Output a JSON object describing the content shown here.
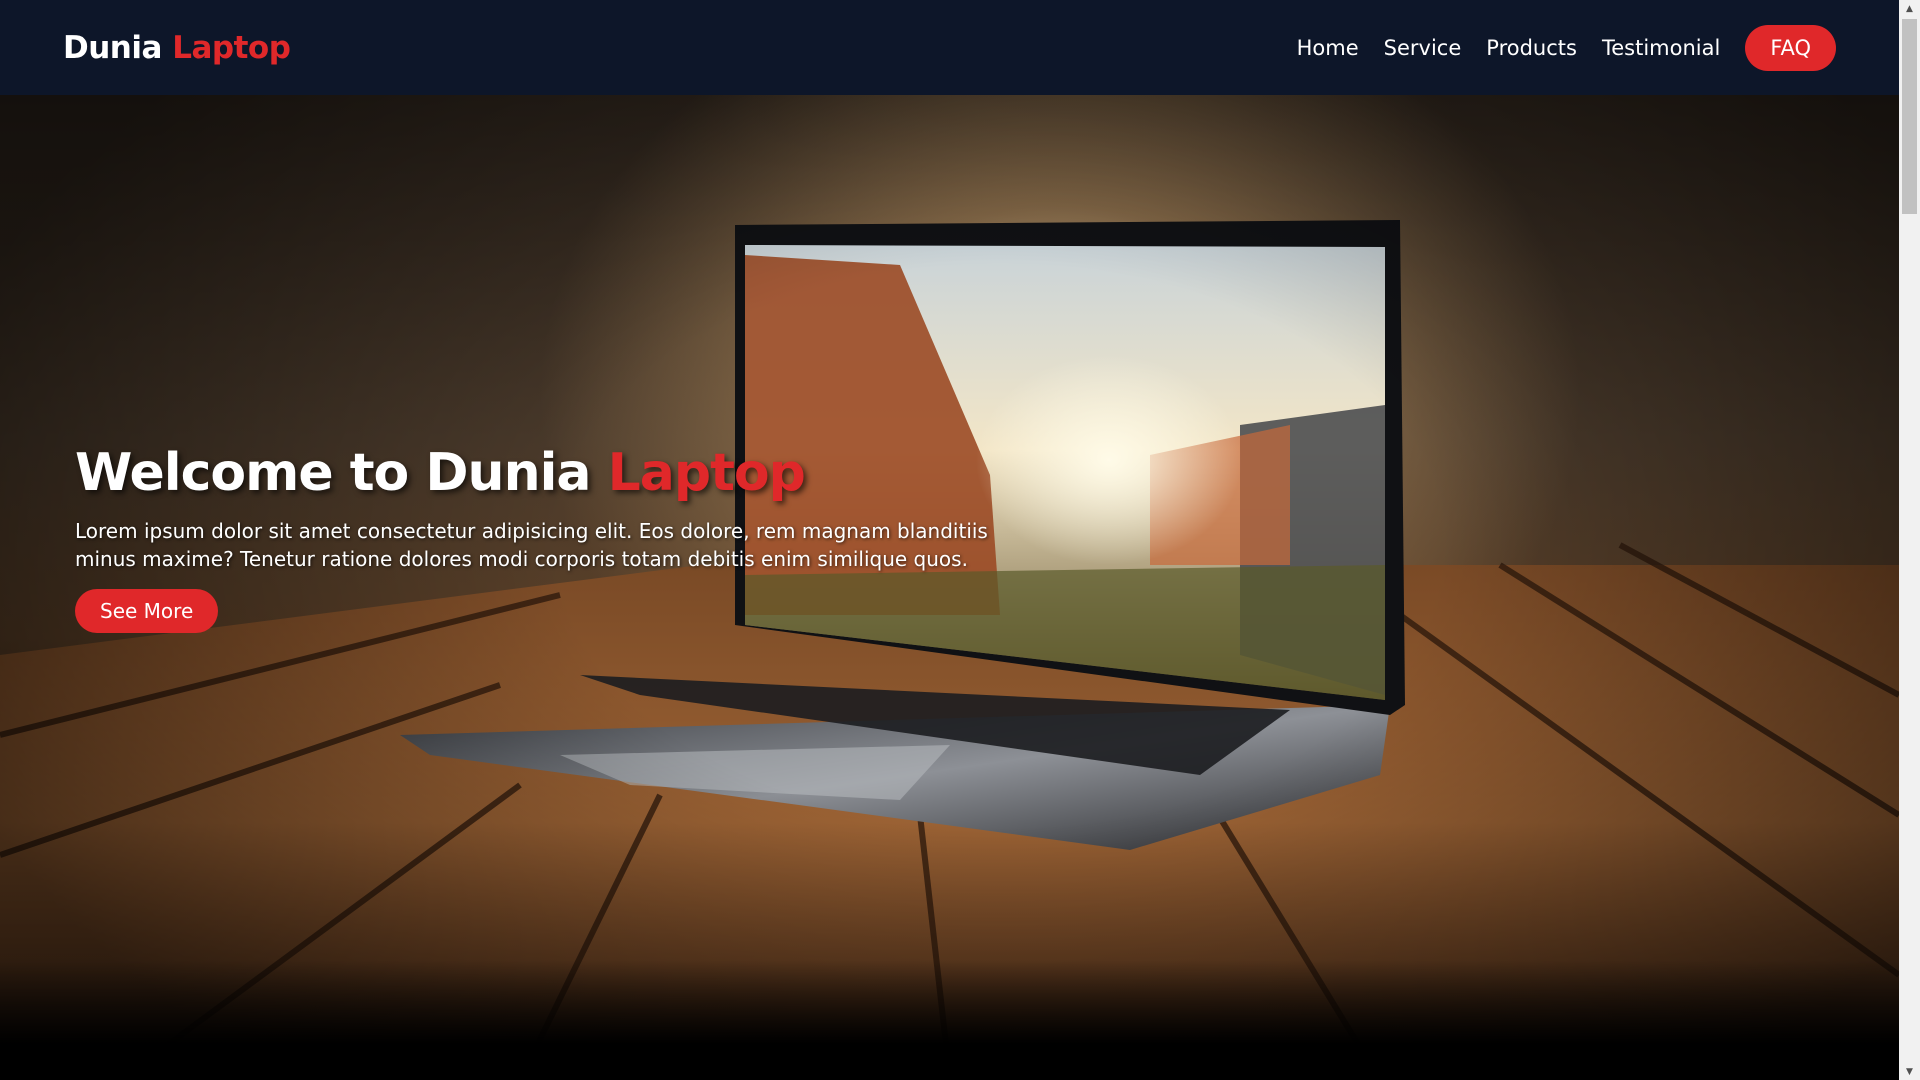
{
  "brand": {
    "name_part1": "Dunia",
    "name_part2": "Laptop",
    "accent_color": "#e0282a"
  },
  "nav": {
    "items": [
      {
        "label": "Home"
      },
      {
        "label": "Service"
      },
      {
        "label": "Products"
      },
      {
        "label": "Testimonial"
      }
    ],
    "cta_label": "FAQ"
  },
  "hero": {
    "title_part1": "Welcome to Dunia",
    "title_part2": "Laptop",
    "description": "Lorem ipsum dolor sit amet consectetur adipisicing elit. Eos dolore, rem magnam blanditiis minus maxime? Tenetur ratione dolores modi corporis totam debitis enim similique quos.",
    "button_label": "See More",
    "background_image": "laptop-on-wooden-table"
  },
  "scrollbar": {
    "up_icon": "arrow-up-icon",
    "down_icon": "arrow-down-icon"
  }
}
